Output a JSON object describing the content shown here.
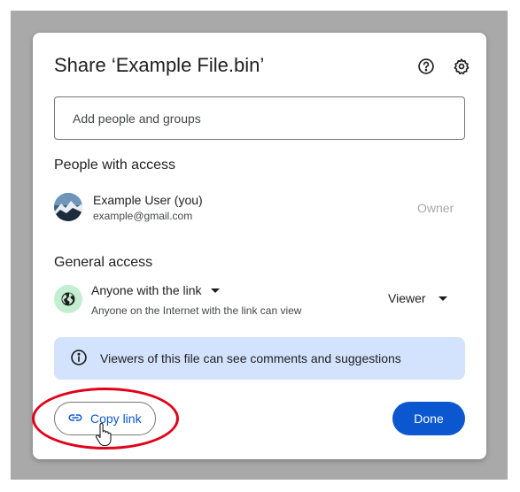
{
  "dialog": {
    "title": "Share ‘Example File.bin’",
    "icons": {
      "help": "help-icon",
      "settings": "gear-icon"
    }
  },
  "add_people": {
    "placeholder": "Add people and groups"
  },
  "people_with_access": {
    "heading": "People with access",
    "users": [
      {
        "name": "Example User (you)",
        "email": "example@gmail.com",
        "role": "Owner"
      }
    ]
  },
  "general_access": {
    "heading": "General access",
    "selected": "Anyone with the link",
    "description": "Anyone on the Internet with the link can view",
    "role": "Viewer",
    "icon": "globe-icon"
  },
  "info_banner": {
    "text": "Viewers of this file can see comments and suggestions",
    "icon": "info-icon"
  },
  "actions": {
    "copy_link": "Copy link",
    "done": "Done"
  },
  "colors": {
    "accent": "#0b57d0",
    "info_bg": "#d3e3fd",
    "globe_bg": "#c4eed0",
    "highlight": "#e3001b"
  }
}
